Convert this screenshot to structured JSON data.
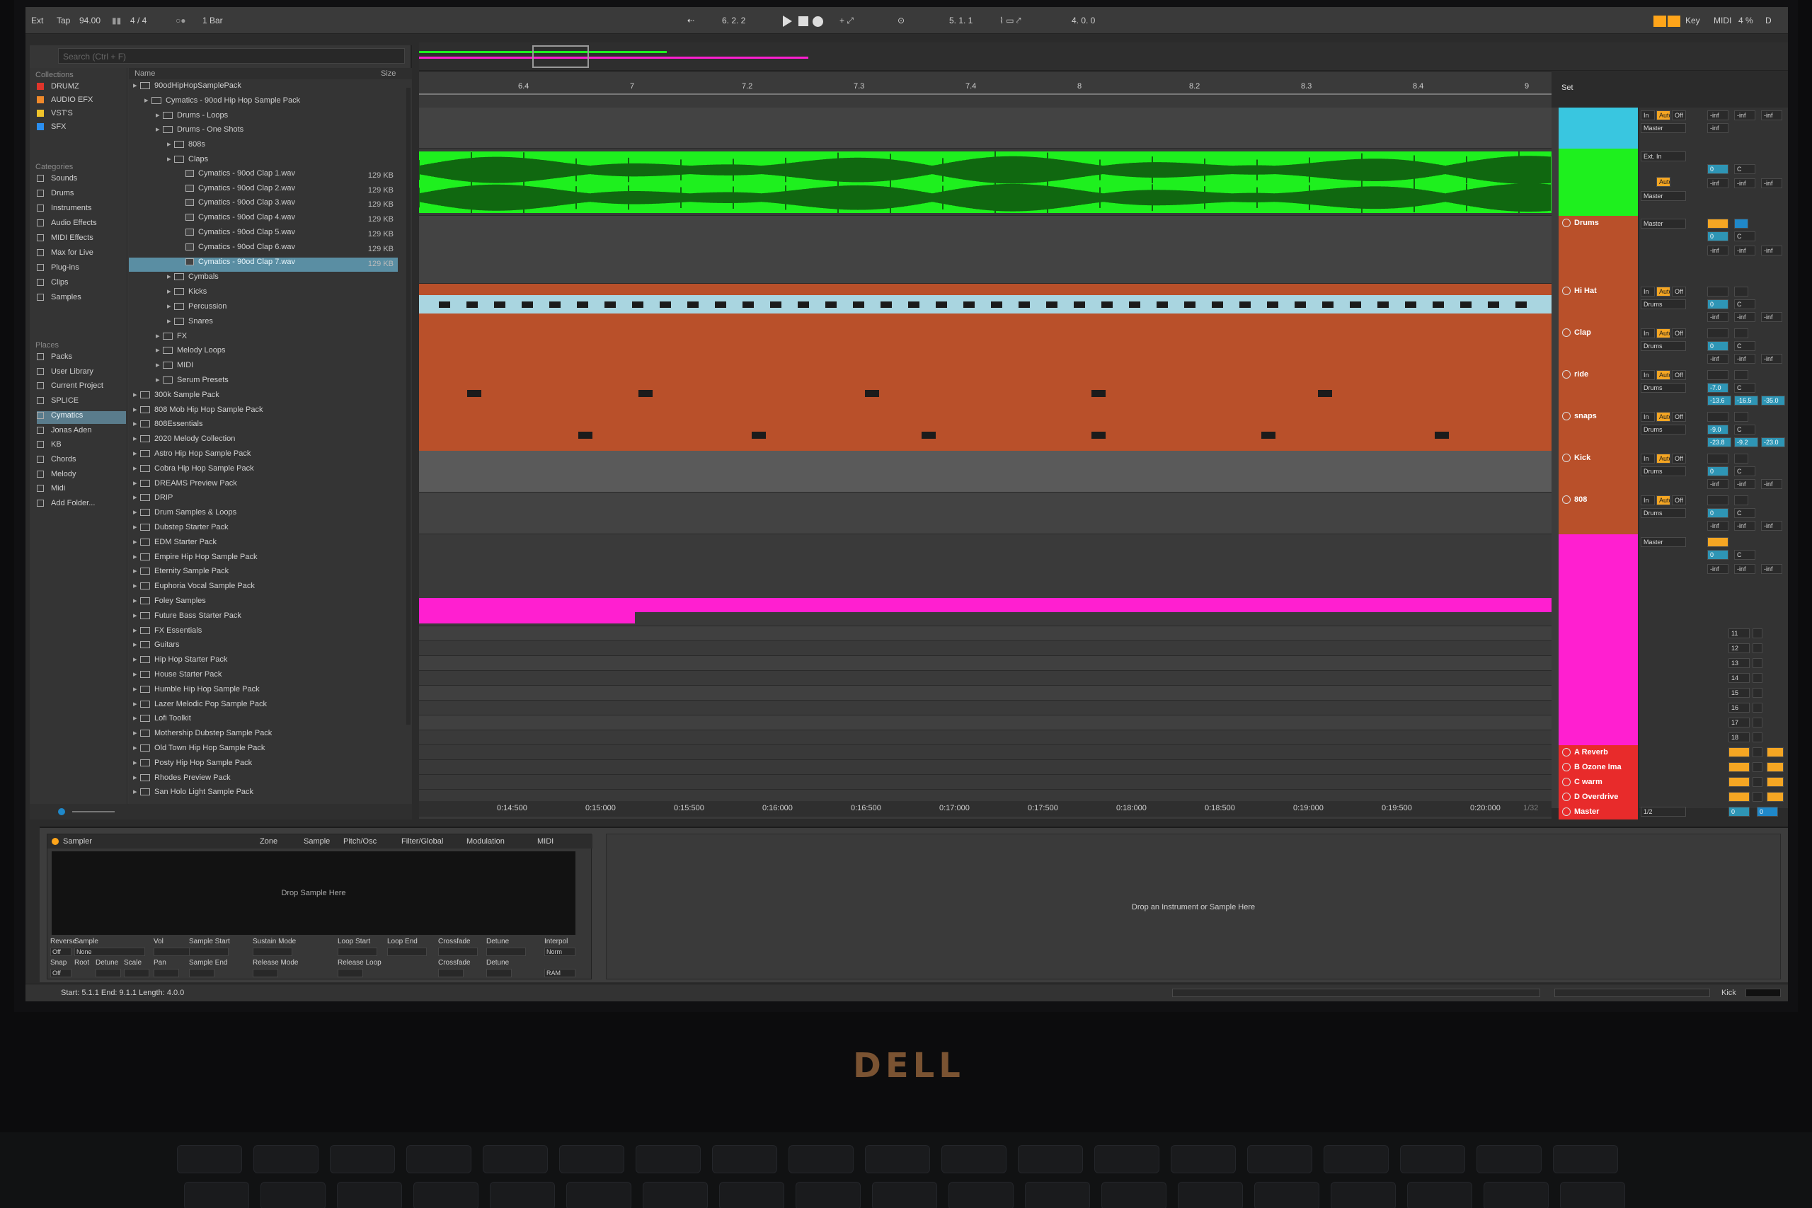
{
  "transport": {
    "ext": "Ext",
    "tap": "Tap",
    "tempo": "94.00",
    "signature": "4 / 4",
    "quantize": "1 Bar",
    "position": "6. 2. 2",
    "loop_start": "5. 1. 1",
    "loop_length": "4. 0. 0",
    "key": "Key",
    "midi": "MIDI",
    "cpu": "4 %",
    "disk": "D"
  },
  "browser": {
    "search_placeholder": "Search (Ctrl + F)",
    "collections_head": "Collections",
    "collections": [
      {
        "label": "DRUMZ",
        "color": "#e0352b"
      },
      {
        "label": "AUDIO EFX",
        "color": "#f08a2b"
      },
      {
        "label": "VST'S",
        "color": "#f0c42b"
      },
      {
        "label": "SFX",
        "color": "#2b8ff0"
      }
    ],
    "categories_head": "Categories",
    "categories": [
      "Sounds",
      "Drums",
      "Instruments",
      "Audio Effects",
      "MIDI Effects",
      "Max for Live",
      "Plug-ins",
      "Clips",
      "Samples"
    ],
    "places_head": "Places",
    "places": [
      "Packs",
      "User Library",
      "Current Project",
      "SPLICE",
      "Cymatics",
      "Jonas Aden",
      "KB",
      "Chords",
      "Melody",
      "Midi",
      "Add Folder..."
    ],
    "name_header": "Name",
    "size_header": "Size",
    "files": [
      {
        "label": "90odHipHopSamplePack",
        "indent": 0,
        "type": "folder",
        "size": ""
      },
      {
        "label": "Cymatics - 90od Hip Hop Sample Pack",
        "indent": 1,
        "type": "folder",
        "size": ""
      },
      {
        "label": "Drums - Loops",
        "indent": 2,
        "type": "folder",
        "size": ""
      },
      {
        "label": "Drums - One Shots",
        "indent": 2,
        "type": "folder",
        "size": ""
      },
      {
        "label": "808s",
        "indent": 3,
        "type": "folder",
        "size": ""
      },
      {
        "label": "Claps",
        "indent": 3,
        "type": "folder",
        "size": ""
      },
      {
        "label": "Cymatics - 90od Clap 1.wav",
        "indent": 4,
        "type": "wav",
        "size": "129 KB"
      },
      {
        "label": "Cymatics - 90od Clap 2.wav",
        "indent": 4,
        "type": "wav",
        "size": "129 KB"
      },
      {
        "label": "Cymatics - 90od Clap 3.wav",
        "indent": 4,
        "type": "wav",
        "size": "129 KB"
      },
      {
        "label": "Cymatics - 90od Clap 4.wav",
        "indent": 4,
        "type": "wav",
        "size": "129 KB"
      },
      {
        "label": "Cymatics - 90od Clap 5.wav",
        "indent": 4,
        "type": "wav",
        "size": "129 KB"
      },
      {
        "label": "Cymatics - 90od Clap 6.wav",
        "indent": 4,
        "type": "wav",
        "size": "129 KB"
      },
      {
        "label": "Cymatics - 90od Clap 7.wav",
        "indent": 4,
        "type": "wav",
        "size": "129 KB",
        "selected": true
      },
      {
        "label": "Cymbals",
        "indent": 3,
        "type": "folder",
        "size": ""
      },
      {
        "label": "Kicks",
        "indent": 3,
        "type": "folder",
        "size": ""
      },
      {
        "label": "Percussion",
        "indent": 3,
        "type": "folder",
        "size": ""
      },
      {
        "label": "Snares",
        "indent": 3,
        "type": "folder",
        "size": ""
      },
      {
        "label": "FX",
        "indent": 2,
        "type": "folder",
        "size": ""
      },
      {
        "label": "Melody Loops",
        "indent": 2,
        "type": "folder",
        "size": ""
      },
      {
        "label": "MIDI",
        "indent": 2,
        "type": "folder",
        "size": ""
      },
      {
        "label": "Serum Presets",
        "indent": 2,
        "type": "folder",
        "size": ""
      },
      {
        "label": "300k Sample Pack",
        "indent": 0,
        "type": "folder",
        "size": ""
      },
      {
        "label": "808 Mob Hip Hop Sample Pack",
        "indent": 0,
        "type": "folder",
        "size": ""
      },
      {
        "label": "808Essentials",
        "indent": 0,
        "type": "folder",
        "size": ""
      },
      {
        "label": "2020 Melody Collection",
        "indent": 0,
        "type": "folder",
        "size": ""
      },
      {
        "label": "Astro Hip Hop Sample Pack",
        "indent": 0,
        "type": "folder",
        "size": ""
      },
      {
        "label": "Cobra Hip Hop Sample Pack",
        "indent": 0,
        "type": "folder",
        "size": ""
      },
      {
        "label": "DREAMS Preview Pack",
        "indent": 0,
        "type": "folder",
        "size": ""
      },
      {
        "label": "DRIP",
        "indent": 0,
        "type": "folder",
        "size": ""
      },
      {
        "label": "Drum Samples & Loops",
        "indent": 0,
        "type": "folder",
        "size": ""
      },
      {
        "label": "Dubstep Starter Pack",
        "indent": 0,
        "type": "folder",
        "size": ""
      },
      {
        "label": "EDM Starter Pack",
        "indent": 0,
        "type": "folder",
        "size": ""
      },
      {
        "label": "Empire Hip Hop Sample Pack",
        "indent": 0,
        "type": "folder",
        "size": ""
      },
      {
        "label": "Eternity Sample Pack",
        "indent": 0,
        "type": "folder",
        "size": ""
      },
      {
        "label": "Euphoria Vocal Sample Pack",
        "indent": 0,
        "type": "folder",
        "size": ""
      },
      {
        "label": "Foley Samples",
        "indent": 0,
        "type": "folder",
        "size": ""
      },
      {
        "label": "Future Bass Starter Pack",
        "indent": 0,
        "type": "folder",
        "size": ""
      },
      {
        "label": "FX Essentials",
        "indent": 0,
        "type": "folder",
        "size": ""
      },
      {
        "label": "Guitars",
        "indent": 0,
        "type": "folder",
        "size": ""
      },
      {
        "label": "Hip Hop Starter Pack",
        "indent": 0,
        "type": "folder",
        "size": ""
      },
      {
        "label": "House Starter Pack",
        "indent": 0,
        "type": "folder",
        "size": ""
      },
      {
        "label": "Humble Hip Hop Sample Pack",
        "indent": 0,
        "type": "folder",
        "size": ""
      },
      {
        "label": "Lazer Melodic Pop Sample Pack",
        "indent": 0,
        "type": "folder",
        "size": ""
      },
      {
        "label": "Lofi Toolkit",
        "indent": 0,
        "type": "folder",
        "size": ""
      },
      {
        "label": "Mothership Dubstep Sample Pack",
        "indent": 0,
        "type": "folder",
        "size": ""
      },
      {
        "label": "Old Town Hip Hop Sample Pack",
        "indent": 0,
        "type": "folder",
        "size": ""
      },
      {
        "label": "Posty Hip Hop Sample Pack",
        "indent": 0,
        "type": "folder",
        "size": ""
      },
      {
        "label": "Rhodes Preview Pack",
        "indent": 0,
        "type": "folder",
        "size": ""
      },
      {
        "label": "San Holo Light Sample Pack",
        "indent": 0,
        "type": "folder",
        "size": ""
      }
    ]
  },
  "arrangement": {
    "bar_labels": [
      "6.4",
      "7",
      "7.2",
      "7.3",
      "7.4",
      "8",
      "8.2",
      "8.3",
      "8.4",
      "9"
    ],
    "time_labels": [
      "0:14:500",
      "0:15:000",
      "0:15:500",
      "0:16:000",
      "0:16:500",
      "0:17:000",
      "0:17:500",
      "0:18:000",
      "0:18:500",
      "0:19:000",
      "0:19:500",
      "0:20:000"
    ],
    "page_indicator": "1/32",
    "set_label": "Set"
  },
  "tracks": [
    {
      "name": "",
      "color": "#39c6e0",
      "lane": "empty",
      "height": 58
    },
    {
      "name": "",
      "color": "#1ef01e",
      "lane": "audio",
      "height": 95
    },
    {
      "name": "Drums",
      "color": "#b9502a",
      "lane": "group",
      "height": 96
    },
    {
      "name": "Hi Hat",
      "color": "#b9502a",
      "lane": "hihat",
      "height": 59
    },
    {
      "name": "Clap",
      "color": "#b9502a",
      "lane": "clap",
      "height": 59
    },
    {
      "name": "ride",
      "color": "#b9502a",
      "lane": "ride",
      "height": 59
    },
    {
      "name": "snaps",
      "color": "#b9502a",
      "lane": "snaps",
      "height": 59
    },
    {
      "name": "Kick",
      "color": "#b9502a",
      "lane": "kick",
      "height": 59
    },
    {
      "name": "808",
      "color": "#b9502a",
      "lane": "808",
      "height": 59
    },
    {
      "name": "",
      "color": "#ff1fd0",
      "lane": "pink",
      "height": 130
    }
  ],
  "returns": [
    {
      "name": "A Reverb"
    },
    {
      "name": "B Ozone Ima"
    },
    {
      "name": "C warm"
    },
    {
      "name": "D Overdrive"
    },
    {
      "name": "Master"
    }
  ],
  "mixer": {
    "input_master": "Master",
    "input_ext": "Ext. In",
    "in_label": "In",
    "auto_label": "Auto",
    "off_label": "Off",
    "drums_route": "Drums",
    "inf": "-inf",
    "center": "C",
    "ride_vals": [
      "-13.6",
      "-16.5",
      "-35.0"
    ],
    "snaps_vals": [
      "-23.8",
      "-9.2",
      "-23.0"
    ],
    "vol_values": [
      "0",
      "-7.0",
      "-9.0",
      "0"
    ],
    "track_nums": [
      "11",
      "12",
      "13",
      "14",
      "15",
      "16",
      "17",
      "18"
    ],
    "master_sel": "1/2"
  },
  "device": {
    "sampler_title": "Sampler",
    "tabs": [
      "Zone",
      "Sample",
      "Pitch/Osc",
      "Filter/Global",
      "Modulation",
      "MIDI"
    ],
    "drop_sample": "Drop Sample Here",
    "drop_instrument": "Drop an Instrument or Sample Here",
    "params_row1": [
      "Reverse",
      "Sample",
      "Vol",
      "Sample Start",
      "Sustain Mode",
      "Loop Start",
      "Loop End",
      "Crossfade",
      "Detune",
      "Interpol"
    ],
    "params_row2": [
      "Snap",
      "Root",
      "Detune",
      "Scale",
      "Pan",
      "Sample End",
      "Release Mode",
      "Release Loop",
      "Crossfade",
      "Detune"
    ],
    "reverse_val": "Off",
    "sample_val": "None",
    "snap_val": "Off",
    "interp_val": "Norm",
    "ram_val": "RAM"
  },
  "status": {
    "selection": "Start: 5.1.1  End: 9.1.1  Length: 4.0.0",
    "track_name": "Kick"
  },
  "brand": "DELL"
}
